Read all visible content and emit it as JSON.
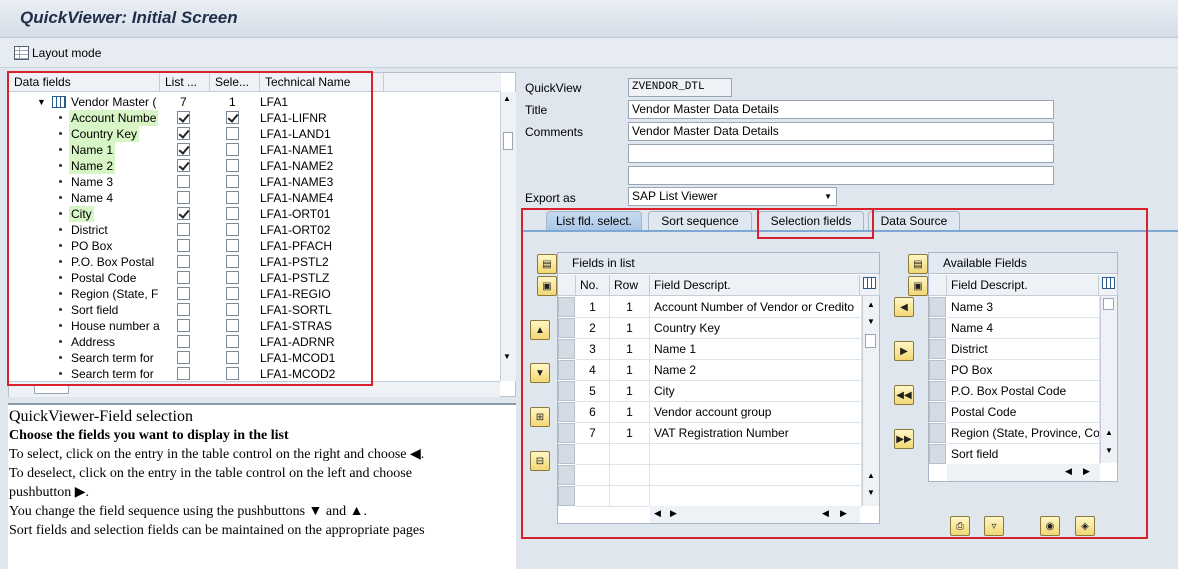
{
  "window": {
    "title": "QuickViewer: Initial Screen"
  },
  "toolbar": {
    "layout_mode": "Layout mode"
  },
  "tree": {
    "headers": [
      "Data fields",
      "List ...",
      "Sele...",
      "Technical Name"
    ],
    "root": {
      "label": "Vendor Master (",
      "list": "7",
      "sel": "1",
      "tech": "LFA1"
    },
    "rows": [
      {
        "label": "Account Numbe",
        "hl": true,
        "list": true,
        "sel": true,
        "tech": "LFA1-LIFNR"
      },
      {
        "label": "Country Key",
        "hl": true,
        "list": true,
        "sel": false,
        "tech": "LFA1-LAND1"
      },
      {
        "label": "Name 1",
        "hl": true,
        "list": true,
        "sel": false,
        "tech": "LFA1-NAME1"
      },
      {
        "label": "Name 2",
        "hl": true,
        "list": true,
        "sel": false,
        "tech": "LFA1-NAME2"
      },
      {
        "label": "Name 3",
        "hl": false,
        "list": false,
        "sel": false,
        "tech": "LFA1-NAME3"
      },
      {
        "label": "Name 4",
        "hl": false,
        "list": false,
        "sel": false,
        "tech": "LFA1-NAME4"
      },
      {
        "label": "City",
        "hl": true,
        "list": true,
        "sel": false,
        "tech": "LFA1-ORT01"
      },
      {
        "label": "District",
        "hl": false,
        "list": false,
        "sel": false,
        "tech": "LFA1-ORT02"
      },
      {
        "label": "PO Box",
        "hl": false,
        "list": false,
        "sel": false,
        "tech": "LFA1-PFACH"
      },
      {
        "label": "P.O. Box Postal",
        "hl": false,
        "list": false,
        "sel": false,
        "tech": "LFA1-PSTL2"
      },
      {
        "label": "Postal Code",
        "hl": false,
        "list": false,
        "sel": false,
        "tech": "LFA1-PSTLZ"
      },
      {
        "label": "Region (State, F",
        "hl": false,
        "list": false,
        "sel": false,
        "tech": "LFA1-REGIO"
      },
      {
        "label": "Sort field",
        "hl": false,
        "list": false,
        "sel": false,
        "tech": "LFA1-SORTL"
      },
      {
        "label": "House number a",
        "hl": false,
        "list": false,
        "sel": false,
        "tech": "LFA1-STRAS"
      },
      {
        "label": "Address",
        "hl": false,
        "list": false,
        "sel": false,
        "tech": "LFA1-ADRNR"
      },
      {
        "label": "Search term for",
        "hl": false,
        "list": false,
        "sel": false,
        "tech": "LFA1-MCOD1"
      },
      {
        "label": "Search term for",
        "hl": false,
        "list": false,
        "sel": false,
        "tech": "LFA1-MCOD2"
      }
    ]
  },
  "help": {
    "title": "QuickViewer-Field selection",
    "subtitle": "Choose the fields you want to display in the list",
    "line1": "To select, click on the entry in the table control on the right and choose",
    "line2": "To deselect, click on the entry in the table control on the left and choose",
    "line2b": "pushbutton",
    "line3a": "You change the field sequence using the pushbuttons",
    "line3b": "and",
    "line4": "Sort fields and selection fields can be maintained on the appropriate pages"
  },
  "form": {
    "quickview_label": "QuickView",
    "quickview_value": "ZVENDOR_DTL",
    "title_label": "Title",
    "title_value": "Vendor Master Data Details",
    "comments_label": "Comments",
    "comments_value": "Vendor Master Data Details",
    "export_label": "Export as",
    "export_value": "SAP List Viewer"
  },
  "tabs": [
    "List fld. select.",
    "Sort sequence",
    "Selection fields",
    "Data Source"
  ],
  "fields_in_list": {
    "caption": "Fields in list",
    "headers": [
      "No.",
      "Row",
      "Field Descript."
    ],
    "rows": [
      {
        "no": "1",
        "row": "1",
        "desc": "Account Number of Vendor or Credito"
      },
      {
        "no": "2",
        "row": "1",
        "desc": "Country Key"
      },
      {
        "no": "3",
        "row": "1",
        "desc": "Name 1"
      },
      {
        "no": "4",
        "row": "1",
        "desc": "Name 2"
      },
      {
        "no": "5",
        "row": "1",
        "desc": "City"
      },
      {
        "no": "6",
        "row": "1",
        "desc": "Vendor account group"
      },
      {
        "no": "7",
        "row": "1",
        "desc": "VAT Registration Number"
      }
    ]
  },
  "available_fields": {
    "caption": "Available Fields",
    "header": "Field Descript.",
    "rows": [
      "Name 3",
      "Name 4",
      "District",
      "PO Box",
      "P.O. Box Postal Code",
      "Postal Code",
      "Region (State, Province, Co",
      "Sort field"
    ]
  },
  "colors": {
    "highlight": "#d7f5c5",
    "red_box": "#d9202b",
    "tab_active": "#a9c6e6"
  }
}
